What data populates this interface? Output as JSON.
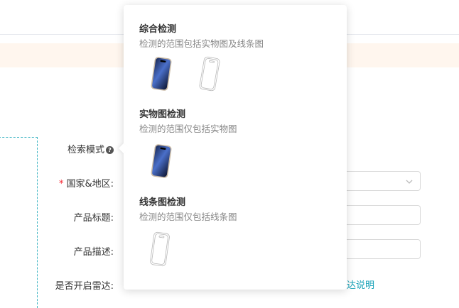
{
  "form": {
    "search_mode_label": "检索模式",
    "help_icon_glyph": "?",
    "country_required_mark": "*",
    "country_label": "国家&地区:",
    "product_title_label": "产品标题:",
    "product_desc_label": "产品描述:",
    "radar_label": "是否开启雷达:",
    "radar_link": "达说明"
  },
  "popover": {
    "options": [
      {
        "title": "综合检测",
        "description": "检测的范围包括实物图及线条图",
        "images": [
          "phone-photo-icon",
          "phone-line-drawing-icon"
        ]
      },
      {
        "title": "实物图检测",
        "description": "检测的范围仅包括实物图",
        "images": [
          "phone-photo-icon"
        ]
      },
      {
        "title": "线条图检测",
        "description": "检测的范围仅包括线条图",
        "images": [
          "phone-line-drawing-icon"
        ]
      }
    ]
  },
  "colors": {
    "accent_teal": "#17a2b8",
    "dashed_border": "#41b6c4",
    "notice_bg": "#fff6ee",
    "required_red": "#f5222d"
  }
}
